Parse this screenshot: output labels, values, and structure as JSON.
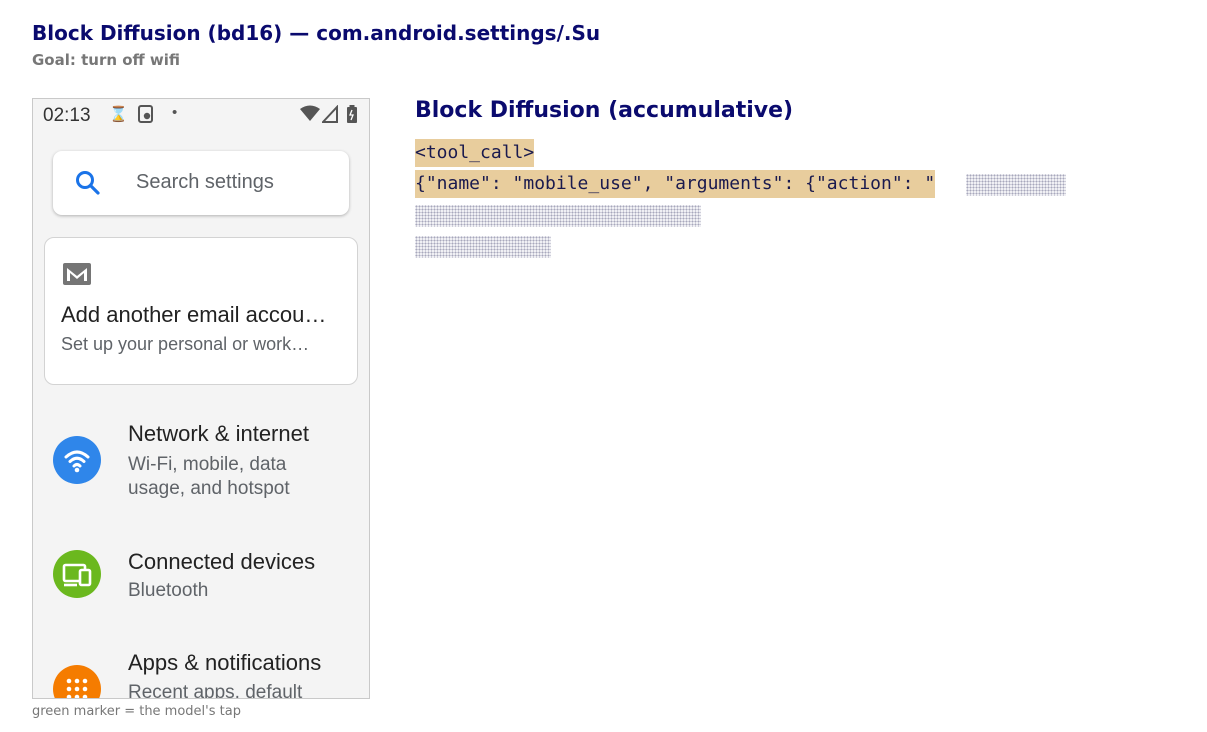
{
  "header": {
    "title": "Block Diffusion (bd16) — com.android.settings/.Su",
    "goal": "Goal: turn off wifi"
  },
  "phone": {
    "status_bar": {
      "time": "02:13",
      "icons": [
        "hourglass-icon",
        "sim-settings-icon",
        "dot-icon",
        "wifi-signal-icon",
        "cell-signal-icon",
        "battery-icon"
      ]
    },
    "search": {
      "placeholder": "Search settings"
    },
    "suggestion": {
      "icon": "mail-icon",
      "title": "Add another email accou…",
      "subtitle": "Set up your personal or work…"
    },
    "items": [
      {
        "title": "Network & internet",
        "subtitle": "Wi-Fi, mobile, data usage, and hotspot",
        "icon": "wifi-icon",
        "color": "#2f86ea"
      },
      {
        "title": "Connected devices",
        "subtitle": "Bluetooth",
        "icon": "devices-icon",
        "color": "#6bb81e"
      },
      {
        "title": "Apps & notifications",
        "subtitle": "Recent apps, default",
        "icon": "apps-grid-icon",
        "color": "#f57c00"
      }
    ]
  },
  "panel": {
    "title": "Block Diffusion (accumulative)",
    "lines": [
      "<tool_call>",
      "{\"name\": \"mobile_use\", \"arguments\": {\"action\": \""
    ],
    "highlight_color": "#e8cd9d"
  },
  "caption": "green marker = the model's tap"
}
